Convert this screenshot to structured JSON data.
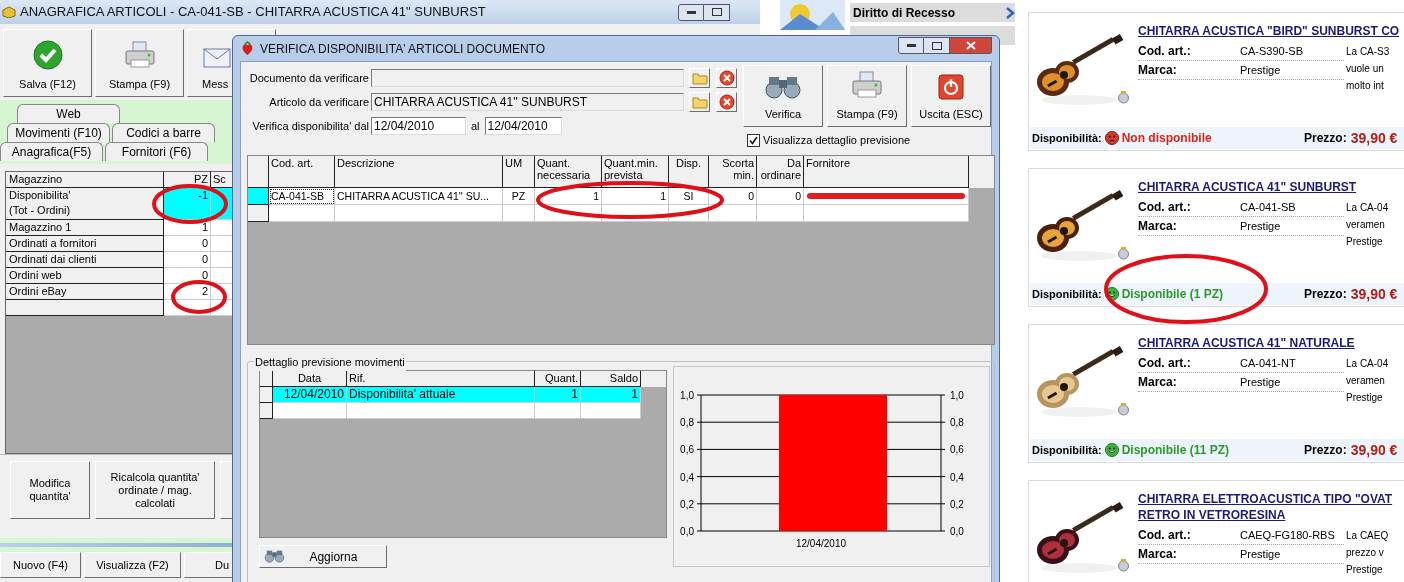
{
  "main_window": {
    "title": "ANAGRAFICA ARTICOLI - CA-041-SB - CHITARRA ACUSTICA 41\" SUNBURST",
    "toolbar": [
      {
        "label": "Salva (F12)",
        "kind": "save"
      },
      {
        "label": "Stampa (F9)",
        "kind": "print"
      },
      {
        "label": "Mess",
        "kind": "message"
      }
    ],
    "tab_rows": [
      {
        "tabs": [
          "Web"
        ]
      },
      {
        "tabs": [
          "Movimenti (F10)",
          "Codici a barre"
        ]
      },
      {
        "tabs": [
          "Anagrafica(F5)",
          "Fornitori (F6)"
        ]
      }
    ],
    "stock_table": {
      "columns": [
        "Magazzino",
        "PZ",
        "Sc"
      ],
      "rows": [
        {
          "label": "Disponibilita'",
          "note": "(Tot - Ordini)",
          "value": "-1",
          "selected": true
        },
        {
          "label": "Magazzino 1",
          "value": "1",
          "selected": false
        },
        {
          "label": "Ordinati a fornitori",
          "value": "0",
          "selected": false
        },
        {
          "label": "Ordinati dai clienti",
          "value": "0",
          "selected": false
        },
        {
          "label": "Ordini web",
          "value": "0",
          "selected": false
        },
        {
          "label": "Ordini eBay",
          "value": "2",
          "selected": false
        }
      ]
    },
    "actions": [
      "Modifica quantita'",
      "Ricalcola quantita' ordinate / mag. calcolati"
    ],
    "bottom_buttons": [
      "Nuovo (F4)",
      "Visualizza (F2)",
      "Du"
    ]
  },
  "dialog": {
    "title": "VERIFICA DISPONIBILITA' ARTICOLI DOCUMENTO",
    "lookups": [
      {
        "label": "Documento da verificare"
      },
      {
        "label": "Articolo da verificare",
        "value": "CHITARRA ACUSTICA 41'' SUNBURST"
      }
    ],
    "period": {
      "label": "Verifica disponibilita' dal",
      "from": "12/04/2010",
      "to_label": "al",
      "to": "12/04/2010"
    },
    "buttons": [
      {
        "label": "Verifica",
        "kind": "check"
      },
      {
        "label": "Stampa (F9)",
        "kind": "print"
      },
      {
        "label": "Uscita (ESC)",
        "kind": "exit"
      }
    ],
    "detail_checkbox": {
      "label": "Visualizza dettaglio previsione",
      "checked": true
    },
    "grid": {
      "columns": [
        "Cod. art.",
        "Descrizione",
        "UM",
        "Quant. necessaria",
        "Quant.min. prevista",
        "Disp.",
        "Scorta min.",
        "Da ordinare",
        "Fornitore"
      ],
      "rows": [
        {
          "cells": [
            "CA-041-SB",
            "CHITARRA ACUSTICA 41'' SU...",
            "PZ",
            "1",
            "1",
            "SI",
            "0",
            "0"
          ],
          "selected": true,
          "redacted": true
        }
      ]
    },
    "detail": {
      "title": "Dettaglio previsione movimenti",
      "columns": [
        "Data",
        "Rif.",
        "Quant.",
        "Saldo"
      ],
      "rows": [
        {
          "cells": [
            "12/04/2010",
            "Disponibilita' attuale",
            "1",
            "1"
          ],
          "selected": true
        }
      ],
      "refresh_button": "Aggiorna",
      "chart_data": {
        "type": "bar",
        "grid": true,
        "categories": [
          "12/04/2010"
        ],
        "series": [
          {
            "color": "#ff0000",
            "values": [
              1
            ]
          }
        ],
        "ylim": [
          0,
          1
        ],
        "yticks": [
          {
            "value": 0,
            "label": "0,0"
          },
          {
            "value": 0.2,
            "label": "0,2"
          },
          {
            "value": 0.4,
            "label": "0,4"
          },
          {
            "value": 0.6,
            "label": "0,6"
          },
          {
            "value": 0.8,
            "label": "0,8"
          },
          {
            "value": 1,
            "label": "1,0"
          }
        ]
      }
    }
  },
  "web": {
    "nav": [
      "Diritto di Recesso"
    ],
    "products": [
      {
        "title_lines": [
          "CHITARRA ACUSTICA \"BIRD\" SUNBURST CO"
        ],
        "code_label": "Cod. art.:",
        "code": "CA-S390-SB",
        "brand_label": "Marca:",
        "brand": "Prestige",
        "description_lines": [
          "La CA-S3",
          "vuole un",
          "molto int"
        ],
        "availability_label": "Disponibilità:",
        "available": false,
        "availability": "Non disponibile",
        "price_label": "Prezzo:",
        "price": "39,90 €"
      },
      {
        "title_lines": [
          "CHITARRA ACUSTICA 41\" SUNBURST"
        ],
        "code_label": "Cod. art.:",
        "code": "CA-041-SB",
        "brand_label": "Marca:",
        "brand": "Prestige",
        "description_lines": [
          "La CA-04",
          "veramen",
          "Prestige"
        ],
        "availability_label": "Disponibilità:",
        "available": true,
        "availability": "Disponibile (1 PZ)",
        "price_label": "Prezzo:",
        "price": "39,90 €"
      },
      {
        "title_lines": [
          "CHITARRA ACUSTICA 41\" NATURALE"
        ],
        "code_label": "Cod. art.:",
        "code": "CA-041-NT",
        "brand_label": "Marca:",
        "brand": "Prestige",
        "description_lines": [
          "La CA-04",
          "veramen",
          "Prestige"
        ],
        "availability_label": "Disponibilità:",
        "available": true,
        "availability": "Disponibile (11 PZ)",
        "price_label": "Prezzo:",
        "price": "39,90 €"
      },
      {
        "title_lines": [
          "CHITARRA ELETTROACUSTICA TIPO \"OVAT",
          "RETRO IN VETRORESINA"
        ],
        "code_label": "Cod. art.:",
        "code": "CAEQ-FG180-RBS",
        "brand_label": "Marca:",
        "brand": "Prestige",
        "description_lines": [
          "La CAEQ",
          "prezzo v",
          "Prestige"
        ]
      }
    ]
  }
}
